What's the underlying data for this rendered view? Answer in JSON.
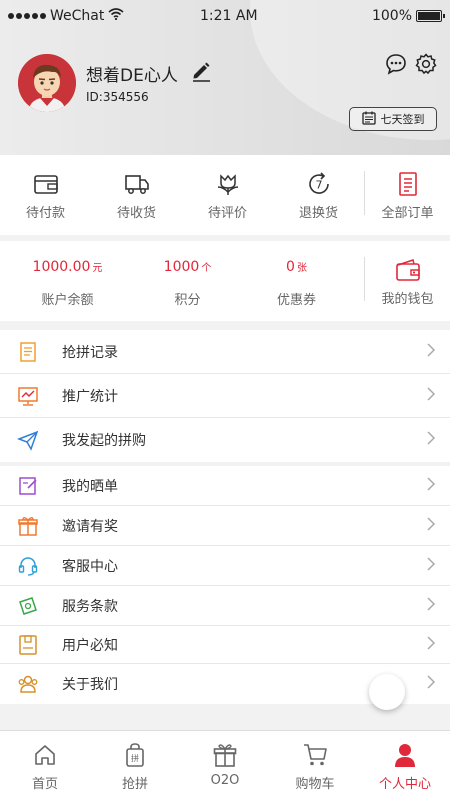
{
  "status_bar": {
    "carrier": "WeChat",
    "time": "1:21 AM",
    "battery": "100%"
  },
  "profile": {
    "username": "想着DE心人",
    "user_id": "ID:354556",
    "signin_label": "七天签到"
  },
  "orders": [
    {
      "label": "待付款",
      "icon": "wallet-icon"
    },
    {
      "label": "待收货",
      "icon": "truck-icon"
    },
    {
      "label": "待评价",
      "icon": "flower-icon"
    },
    {
      "label": "退换货",
      "icon": "return-icon"
    },
    {
      "label": "全部订单",
      "icon": "orders-icon"
    }
  ],
  "wallet": {
    "balance": {
      "value": "1000.00",
      "unit": "元",
      "label": "账户余额"
    },
    "points": {
      "value": "1000",
      "unit": "个",
      "label": "积分"
    },
    "coupons": {
      "value": "0",
      "unit": "张",
      "label": "优惠券"
    },
    "my_wallet_label": "我的钱包"
  },
  "menu": [
    {
      "label": "抢拼记录",
      "icon": "record-icon"
    },
    {
      "label": "推广统计",
      "icon": "stats-icon"
    },
    {
      "label": "我发起的拼购",
      "icon": "send-icon"
    },
    {
      "label": "我的晒单",
      "icon": "edit-icon"
    },
    {
      "label": "邀请有奖",
      "icon": "gift-icon"
    },
    {
      "label": "客服中心",
      "icon": "headset-icon"
    },
    {
      "label": "服务条款",
      "icon": "money-icon"
    },
    {
      "label": "用户必知",
      "icon": "notice-icon"
    },
    {
      "label": "关于我们",
      "icon": "team-icon"
    }
  ],
  "tabs": [
    {
      "label": "首页",
      "icon": "home-icon"
    },
    {
      "label": "抢拼",
      "icon": "bag-icon"
    },
    {
      "label": "O2O",
      "icon": "gift-icon"
    },
    {
      "label": "购物车",
      "icon": "cart-icon"
    },
    {
      "label": "个人中心",
      "icon": "person-icon",
      "active": true
    }
  ],
  "colors": {
    "accent": "#e0283a",
    "header_bg": "#e4e4e4"
  }
}
